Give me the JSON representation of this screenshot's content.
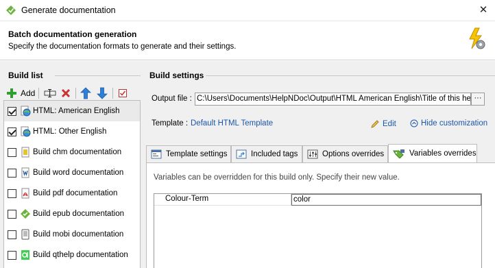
{
  "window": {
    "title": "Generate documentation",
    "close_glyph": "✕"
  },
  "header": {
    "title": "Batch documentation generation",
    "subtitle": "Specify the documentation formats to generate and their settings."
  },
  "build_list": {
    "heading": "Build list",
    "toolbar": {
      "add_label": "Add"
    },
    "items": [
      {
        "label": "HTML: American English",
        "checked": true,
        "selected": true,
        "icon": "html-globe-icon"
      },
      {
        "label": "HTML: Other English",
        "checked": true,
        "selected": false,
        "icon": "html-globe-icon"
      },
      {
        "label": "Build chm documentation",
        "checked": false,
        "selected": false,
        "icon": "chm-icon"
      },
      {
        "label": "Build word documentation",
        "checked": false,
        "selected": false,
        "icon": "word-icon"
      },
      {
        "label": "Build pdf documentation",
        "checked": false,
        "selected": false,
        "icon": "pdf-icon"
      },
      {
        "label": "Build epub documentation",
        "checked": false,
        "selected": false,
        "icon": "epub-icon"
      },
      {
        "label": "Build mobi documentation",
        "checked": false,
        "selected": false,
        "icon": "mobi-icon"
      },
      {
        "label": "Build qthelp documentation",
        "checked": false,
        "selected": false,
        "icon": "qthelp-icon"
      }
    ]
  },
  "build_settings": {
    "heading": "Build settings",
    "output_label": "Output file :",
    "output_value": "C:\\Users\\Documents\\HelpNDoc\\Output\\HTML American English\\Title of this help project",
    "output_browse": "···",
    "template_label": "Template :",
    "template_value": "Default HTML Template",
    "edit_label": "Edit",
    "hide_label": "Hide customization",
    "tabs": [
      {
        "label": "Template settings",
        "active": false
      },
      {
        "label": "Included tags",
        "active": false
      },
      {
        "label": "Options overrides",
        "active": false
      },
      {
        "label": "Variables overrides",
        "active": true
      }
    ],
    "panel_description": "Variables can be overridden for this build only. Specify their new value.",
    "variables": [
      {
        "name": "Colour-Term",
        "value": "color"
      }
    ]
  },
  "colors": {
    "link": "#1a56a8",
    "add_green": "#2e9e2e",
    "delete_red": "#d03030",
    "arrow_blue": "#2f7fd6"
  }
}
